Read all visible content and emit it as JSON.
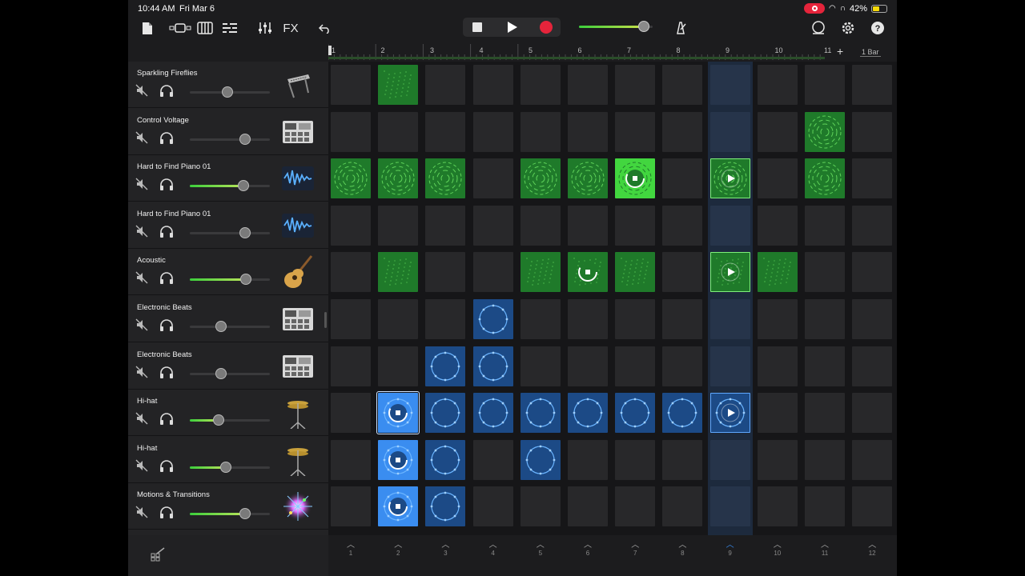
{
  "status": {
    "time": "10:44 AM",
    "date": "Fri Mar 6",
    "battery": "42%"
  },
  "toolbar": {
    "fx_label": "FX"
  },
  "ruler": {
    "bars": [
      "1",
      "2",
      "3",
      "4",
      "5",
      "6",
      "7",
      "8",
      "9",
      "10",
      "11"
    ],
    "length_label": "1 Bar",
    "add_label": "+"
  },
  "tracks": [
    {
      "name": "Sparkling Fireflies",
      "volume": 0.47,
      "active": false,
      "icon": "synth-keyboard-icon"
    },
    {
      "name": "Control Voltage",
      "volume": 0.69,
      "active": false,
      "icon": "drum-machine-icon"
    },
    {
      "name": "Hard to Find Piano 01",
      "volume": 0.67,
      "active": true,
      "icon": "waveform-icon"
    },
    {
      "name": "Hard to Find Piano 01",
      "volume": 0.69,
      "active": false,
      "icon": "waveform-icon"
    },
    {
      "name": "Acoustic",
      "volume": 0.7,
      "active": true,
      "icon": "acoustic-guitar-icon"
    },
    {
      "name": "Electronic Beats",
      "volume": 0.39,
      "active": false,
      "icon": "drum-machine-icon"
    },
    {
      "name": "Electronic Beats",
      "volume": 0.39,
      "active": false,
      "icon": "drum-machine-icon"
    },
    {
      "name": "Hi-hat",
      "volume": 0.36,
      "active": true,
      "icon": "cymbal-icon"
    },
    {
      "name": "Hi-hat",
      "volume": 0.45,
      "active": true,
      "icon": "cymbal-icon"
    },
    {
      "name": "Motions & Transitions",
      "volume": 0.69,
      "active": true,
      "icon": "sparkle-burst-icon"
    }
  ],
  "grid": [
    [
      "-",
      "g",
      "-",
      "-",
      "-",
      "-",
      "-",
      "-",
      "-",
      "-",
      "-",
      "-"
    ],
    [
      "-",
      "-",
      "-",
      "-",
      "-",
      "-",
      "-",
      "-",
      "-",
      "-",
      "g",
      "-"
    ],
    [
      "g",
      "g",
      "g",
      "-",
      "g",
      "g",
      "gb-stop",
      "-",
      "g-play",
      "-",
      "g",
      "-"
    ],
    [
      "-",
      "-",
      "-",
      "-",
      "-",
      "-",
      "-",
      "-",
      "-",
      "-",
      "-",
      "-"
    ],
    [
      "-",
      "g",
      "-",
      "-",
      "g",
      "g-stop",
      "g",
      "-",
      "g-play",
      "g",
      "-",
      "-"
    ],
    [
      "-",
      "-",
      "-",
      "b",
      "-",
      "-",
      "-",
      "-",
      "-",
      "-",
      "-",
      "-"
    ],
    [
      "-",
      "-",
      "b",
      "b",
      "-",
      "-",
      "-",
      "-",
      "-",
      "-",
      "-",
      "-"
    ],
    [
      "-",
      "bb-stop-sel",
      "b",
      "b",
      "b",
      "b",
      "b",
      "b",
      "b-play",
      "-",
      "-",
      "-"
    ],
    [
      "-",
      "bb-stop",
      "b",
      "-",
      "b",
      "-",
      "-",
      "-",
      "-",
      "-",
      "-",
      "-"
    ],
    [
      "-",
      "bb-stop",
      "b",
      "-",
      "-",
      "-",
      "-",
      "-",
      "-",
      "-",
      "-",
      "-"
    ]
  ],
  "scene_triggers": [
    "1",
    "2",
    "3",
    "4",
    "5",
    "6",
    "7",
    "8",
    "9",
    "10",
    "11",
    "12"
  ],
  "active_scene": "9"
}
